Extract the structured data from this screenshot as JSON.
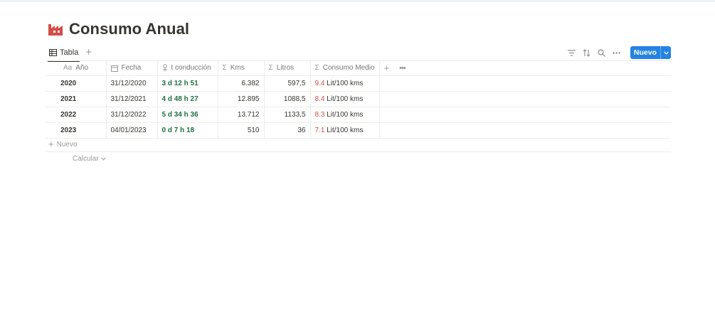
{
  "page": {
    "title": "Consumo Anual",
    "icon": "factory-icon",
    "accent_color": "#d44c47"
  },
  "view": {
    "tab_label": "Tabla",
    "tab_icon": "table-icon",
    "add_view": "+",
    "new_button_label": "Nuevo"
  },
  "table": {
    "columns": [
      {
        "glyph": "Aa",
        "label": "Año"
      },
      {
        "glyph": "date-icon",
        "label": "Fecha"
      },
      {
        "glyph": "formula-icon",
        "label": "t conducción"
      },
      {
        "glyph": "Σ",
        "label": "Kms"
      },
      {
        "glyph": "Σ",
        "label": "Litros"
      },
      {
        "glyph": "Σ",
        "label": "Consumo Medio"
      }
    ],
    "rows": [
      {
        "year": "2020",
        "date": "31/12/2020",
        "duration": "3 d 12 h 51",
        "kms": "6.382",
        "liters": "597,5",
        "consumption": "9.4",
        "unit": "Lit/100 kms"
      },
      {
        "year": "2021",
        "date": "31/12/2021",
        "duration": "4 d 48 h 27",
        "kms": "12.895",
        "liters": "1088,5",
        "consumption": "8.4",
        "unit": "Lit/100 kms"
      },
      {
        "year": "2022",
        "date": "31/12/2022",
        "duration": "5 d 34 h 36",
        "kms": "13.712",
        "liters": "1133,5",
        "consumption": "8.3",
        "unit": "Lit/100 kms"
      },
      {
        "year": "2023",
        "date": "04/01/2023",
        "duration": "0 d 7 h 18",
        "kms": "510",
        "liters": "36",
        "consumption": "7.1",
        "unit": "Lit/100 kms"
      }
    ],
    "new_row_label": "Nuevo",
    "calculate_label": "Calcular"
  }
}
